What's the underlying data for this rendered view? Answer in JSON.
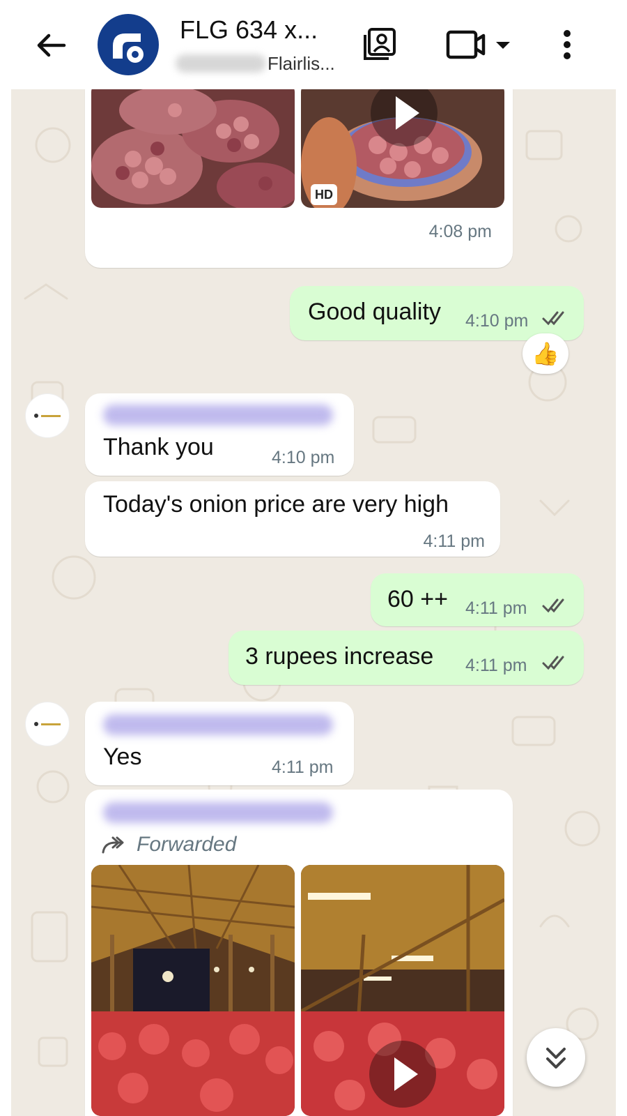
{
  "header": {
    "title": "FLG 634 x...",
    "subtitle": "Flairlis...",
    "back_icon": "arrow-left-icon",
    "contact_card_icon": "contact-card-icon",
    "video_icon": "video-camera-icon",
    "more_icon": "more-vert-icon"
  },
  "messages": [
    {
      "id": "m1",
      "direction": "in",
      "type": "media",
      "time": "4:08 pm",
      "hd_label": "HD"
    },
    {
      "id": "m2",
      "direction": "out",
      "text": "Good quality",
      "time": "4:10 pm",
      "reaction": "👍"
    },
    {
      "id": "m3",
      "direction": "in",
      "text": "Thank you",
      "time": "4:10 pm"
    },
    {
      "id": "m4",
      "direction": "in",
      "text": "Today's onion price are very high",
      "time": "4:11 pm"
    },
    {
      "id": "m5",
      "direction": "out",
      "text": "60 ++",
      "time": "4:11 pm"
    },
    {
      "id": "m6",
      "direction": "out",
      "text": "3 rupees increase",
      "time": "4:11 pm"
    },
    {
      "id": "m7",
      "direction": "in",
      "text": "Yes",
      "time": "4:11 pm"
    },
    {
      "id": "m8",
      "direction": "in",
      "type": "media",
      "forwarded_label": "Forwarded"
    }
  ],
  "colors": {
    "chat_background": "#efeae2",
    "incoming_bubble": "#ffffff",
    "outgoing_bubble": "#d9fdd3",
    "timestamp": "#667781",
    "avatar_blue": "#133d8c"
  }
}
